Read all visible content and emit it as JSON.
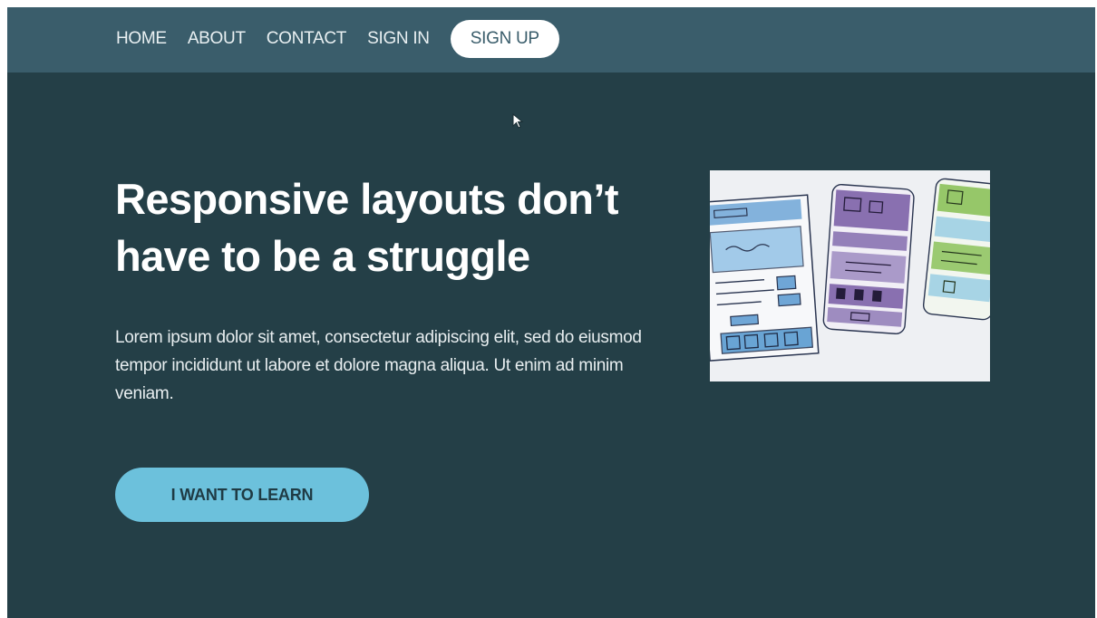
{
  "nav": {
    "links": [
      {
        "label": "HOME"
      },
      {
        "label": "ABOUT"
      },
      {
        "label": "CONTACT"
      },
      {
        "label": "SIGN IN"
      }
    ],
    "signup_label": "SIGN UP"
  },
  "hero": {
    "title": "Responsive layouts don’t have to be a struggle",
    "body": "Lorem ipsum dolor sit amet, consectetur adipiscing elit, sed do eiusmod tempor incididunt ut labore et dolore magna aliqua. Ut enim ad minim veniam.",
    "cta_label": "I WANT TO LEARN",
    "image_subject": "watercolor wireframe sketches"
  },
  "colors": {
    "nav_bg": "#3a5d6b",
    "hero_bg": "#243f47",
    "cta_bg": "#6cc1dc",
    "signup_bg": "#ffffff",
    "sketch_blue": "#5a9bd0",
    "sketch_purple": "#7d62a8",
    "sketch_green": "#8cc25a"
  }
}
